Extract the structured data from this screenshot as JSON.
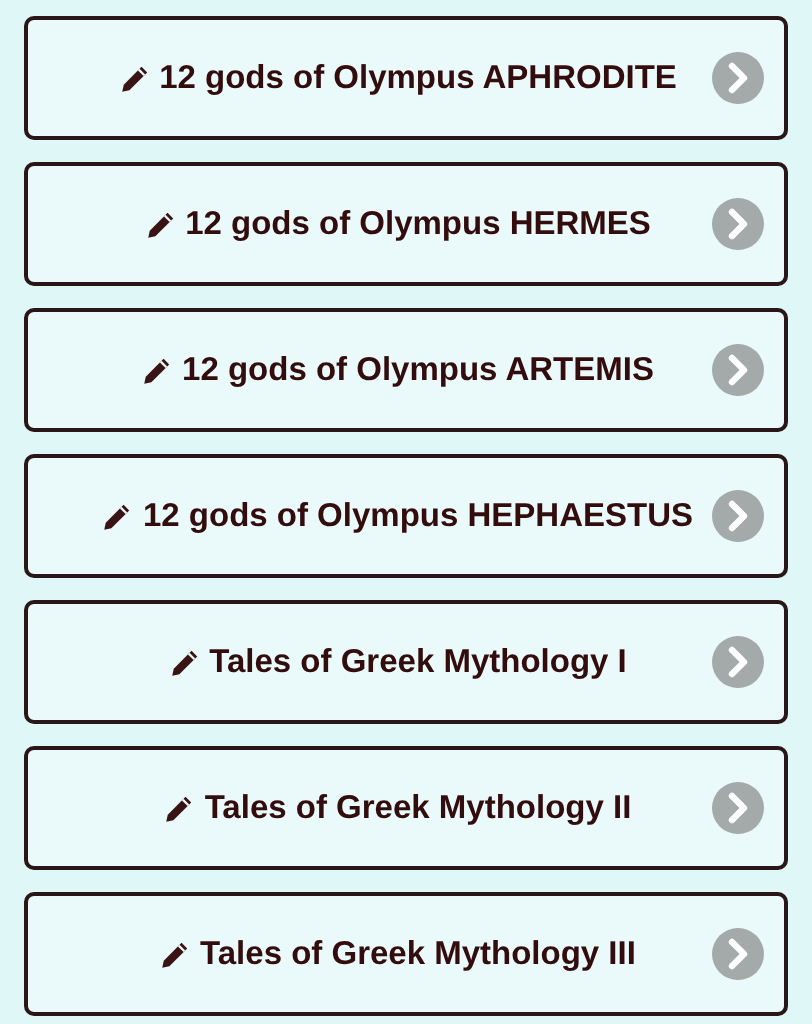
{
  "items": [
    {
      "label": "12 gods of Olympus APHRODITE"
    },
    {
      "label": "12 gods of Olympus HERMES"
    },
    {
      "label": "12 gods of Olympus ARTEMIS"
    },
    {
      "label": "12 gods of Olympus HEPHAESTUS"
    },
    {
      "label": "Tales of Greek Mythology I"
    },
    {
      "label": "Tales of Greek Mythology II"
    },
    {
      "label": "Tales of Greek Mythology III"
    }
  ]
}
